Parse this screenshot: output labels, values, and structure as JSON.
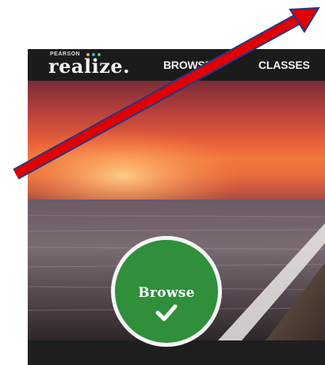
{
  "header": {
    "logo": {
      "brand_small": "PEARSON",
      "brand_main": "realize.",
      "dot_colors": [
        "#e0b43a",
        "#4aa7d8",
        "#6cbf4a"
      ]
    },
    "nav": [
      {
        "label": "BROWSE"
      },
      {
        "label": "CLASSES"
      }
    ]
  },
  "hero": {
    "image": "sunset-over-sea-photo",
    "browse_button": {
      "label": "Browse",
      "icon": "checkmark-icon",
      "color": "#2f8f3b"
    }
  },
  "annotation": {
    "type": "arrow",
    "color": "#e00000",
    "outline_color": "#1e3a8a"
  }
}
